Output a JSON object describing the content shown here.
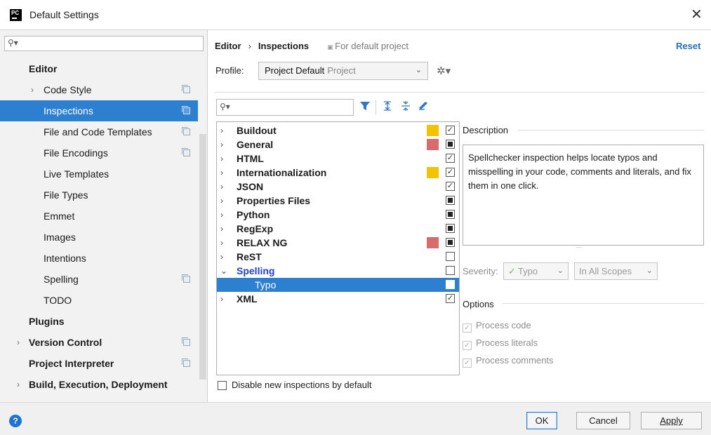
{
  "window": {
    "logo_text": "PC",
    "title": "Default Settings",
    "close_glyph": "✕"
  },
  "sidebar": {
    "search_placeholder": "",
    "items": [
      {
        "label": "Editor",
        "bold": true,
        "arrow": "",
        "copy": false
      },
      {
        "label": "Code Style",
        "bold": false,
        "arrow": "›",
        "copy": true
      },
      {
        "label": "Inspections",
        "bold": false,
        "arrow": "",
        "copy": true,
        "selected": true
      },
      {
        "label": "File and Code Templates",
        "bold": false,
        "arrow": "",
        "copy": true
      },
      {
        "label": "File Encodings",
        "bold": false,
        "arrow": "",
        "copy": true
      },
      {
        "label": "Live Templates",
        "bold": false,
        "arrow": "",
        "copy": false
      },
      {
        "label": "File Types",
        "bold": false,
        "arrow": "",
        "copy": false
      },
      {
        "label": "Emmet",
        "bold": false,
        "arrow": "",
        "copy": false
      },
      {
        "label": "Images",
        "bold": false,
        "arrow": "",
        "copy": false
      },
      {
        "label": "Intentions",
        "bold": false,
        "arrow": "",
        "copy": false
      },
      {
        "label": "Spelling",
        "bold": false,
        "arrow": "",
        "copy": true
      },
      {
        "label": "TODO",
        "bold": false,
        "arrow": "",
        "copy": false
      },
      {
        "label": "Plugins",
        "bold": true,
        "arrow": "",
        "copy": false
      },
      {
        "label": "Version Control",
        "bold": true,
        "arrow": "›",
        "copy": true
      },
      {
        "label": "Project Interpreter",
        "bold": true,
        "arrow": "",
        "copy": true
      },
      {
        "label": "Build, Execution, Deployment",
        "bold": true,
        "arrow": "›",
        "copy": false
      }
    ]
  },
  "header": {
    "crumb_editor": "Editor",
    "crumb_sep": "›",
    "crumb_inspections": "Inspections",
    "crumb_scope": "For default project",
    "reset_label": "Reset"
  },
  "profile": {
    "label": "Profile:",
    "value": "Project Default",
    "sub": "Project",
    "dropdown_glyph": "⌄",
    "gear_glyph": "✲▾"
  },
  "inspections": {
    "search_value": "",
    "tree": [
      {
        "name": "Buildout",
        "arrow": "›",
        "severity": "#f2c400",
        "check": "checked"
      },
      {
        "name": "General",
        "arrow": "›",
        "severity": "#d86b6b",
        "check": "partial"
      },
      {
        "name": "HTML",
        "arrow": "›",
        "severity": "",
        "check": "checked"
      },
      {
        "name": "Internationalization",
        "arrow": "›",
        "severity": "#f2c400",
        "check": "checked"
      },
      {
        "name": "JSON",
        "arrow": "›",
        "severity": "",
        "check": "checked"
      },
      {
        "name": "Properties Files",
        "arrow": "›",
        "severity": "",
        "check": "partial"
      },
      {
        "name": "Python",
        "arrow": "›",
        "severity": "",
        "check": "partial"
      },
      {
        "name": "RegExp",
        "arrow": "›",
        "severity": "",
        "check": "partial"
      },
      {
        "name": "RELAX NG",
        "arrow": "›",
        "severity": "#d86b6b",
        "check": "partial"
      },
      {
        "name": "ReST",
        "arrow": "›",
        "severity": "",
        "check": "empty"
      },
      {
        "name": "Spelling",
        "arrow": "⌄",
        "severity": "",
        "check": "empty",
        "link": true
      },
      {
        "name": "Typo",
        "arrow": "",
        "severity": "",
        "check": "empty",
        "child": true,
        "selected": true
      },
      {
        "name": "XML",
        "arrow": "›",
        "severity": "",
        "check": "checked"
      }
    ],
    "disable_label": "Disable new inspections by default"
  },
  "description": {
    "title": "Description",
    "text": "Spellchecker inspection helps locate typos and misspelling in your code, comments and literals, and fix them in one click."
  },
  "severity": {
    "label": "Severity:",
    "value": "Typo",
    "scope": "In All Scopes"
  },
  "options": {
    "title": "Options",
    "items": [
      "Process code",
      "Process literals",
      "Process comments"
    ]
  },
  "footer": {
    "help_glyph": "?",
    "ok": "OK",
    "cancel": "Cancel",
    "apply": "Apply"
  },
  "colors": {
    "selection": "#2d7fd0",
    "link": "#2470b3",
    "severity_warning": "#f2c400",
    "severity_error": "#d86b6b"
  }
}
